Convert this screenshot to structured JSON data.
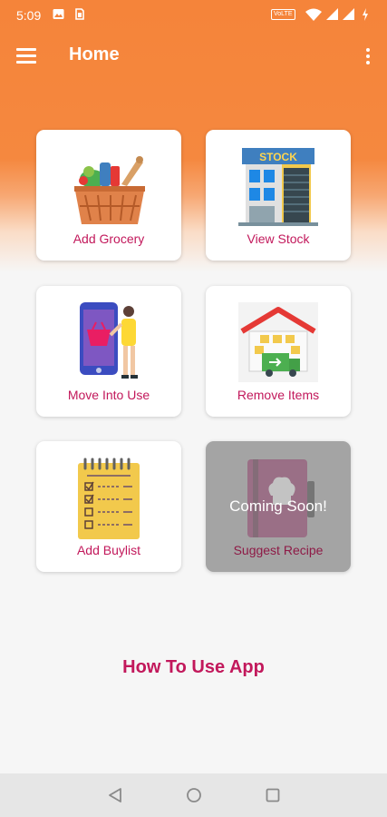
{
  "status_bar": {
    "time": "5:09",
    "icons": [
      "image-icon",
      "sim-icon",
      "volte-icon",
      "wifi-icon",
      "signal-icon",
      "signal-icon",
      "battery-charging-icon"
    ],
    "volte_text": "VoLTE"
  },
  "app_bar": {
    "title": "Home",
    "menu_icon": "hamburger-menu-icon",
    "overflow_icon": "more-vertical-icon"
  },
  "tiles": [
    {
      "label": "Add Grocery",
      "icon": "grocery-basket-icon"
    },
    {
      "label": "View Stock",
      "icon": "stock-warehouse-icon",
      "icon_text": "STOCK"
    },
    {
      "label": "Move Into Use",
      "icon": "mobile-shopping-icon"
    },
    {
      "label": "Remove Items",
      "icon": "delivery-truck-icon"
    },
    {
      "label": "Add Buylist",
      "icon": "checklist-notepad-icon"
    },
    {
      "label": "Suggest Recipe",
      "icon": "recipe-book-icon",
      "overlay": "Coming Soon!",
      "disabled": true
    }
  ],
  "how_to_link": "How To Use App",
  "nav_bar": {
    "icons": [
      "back-icon",
      "home-icon",
      "recents-icon"
    ]
  },
  "colors": {
    "primary": "#f5843a",
    "accent_text": "#c2185b",
    "background": "#f6f6f6",
    "disabled_tile": "#a4a4a4"
  }
}
